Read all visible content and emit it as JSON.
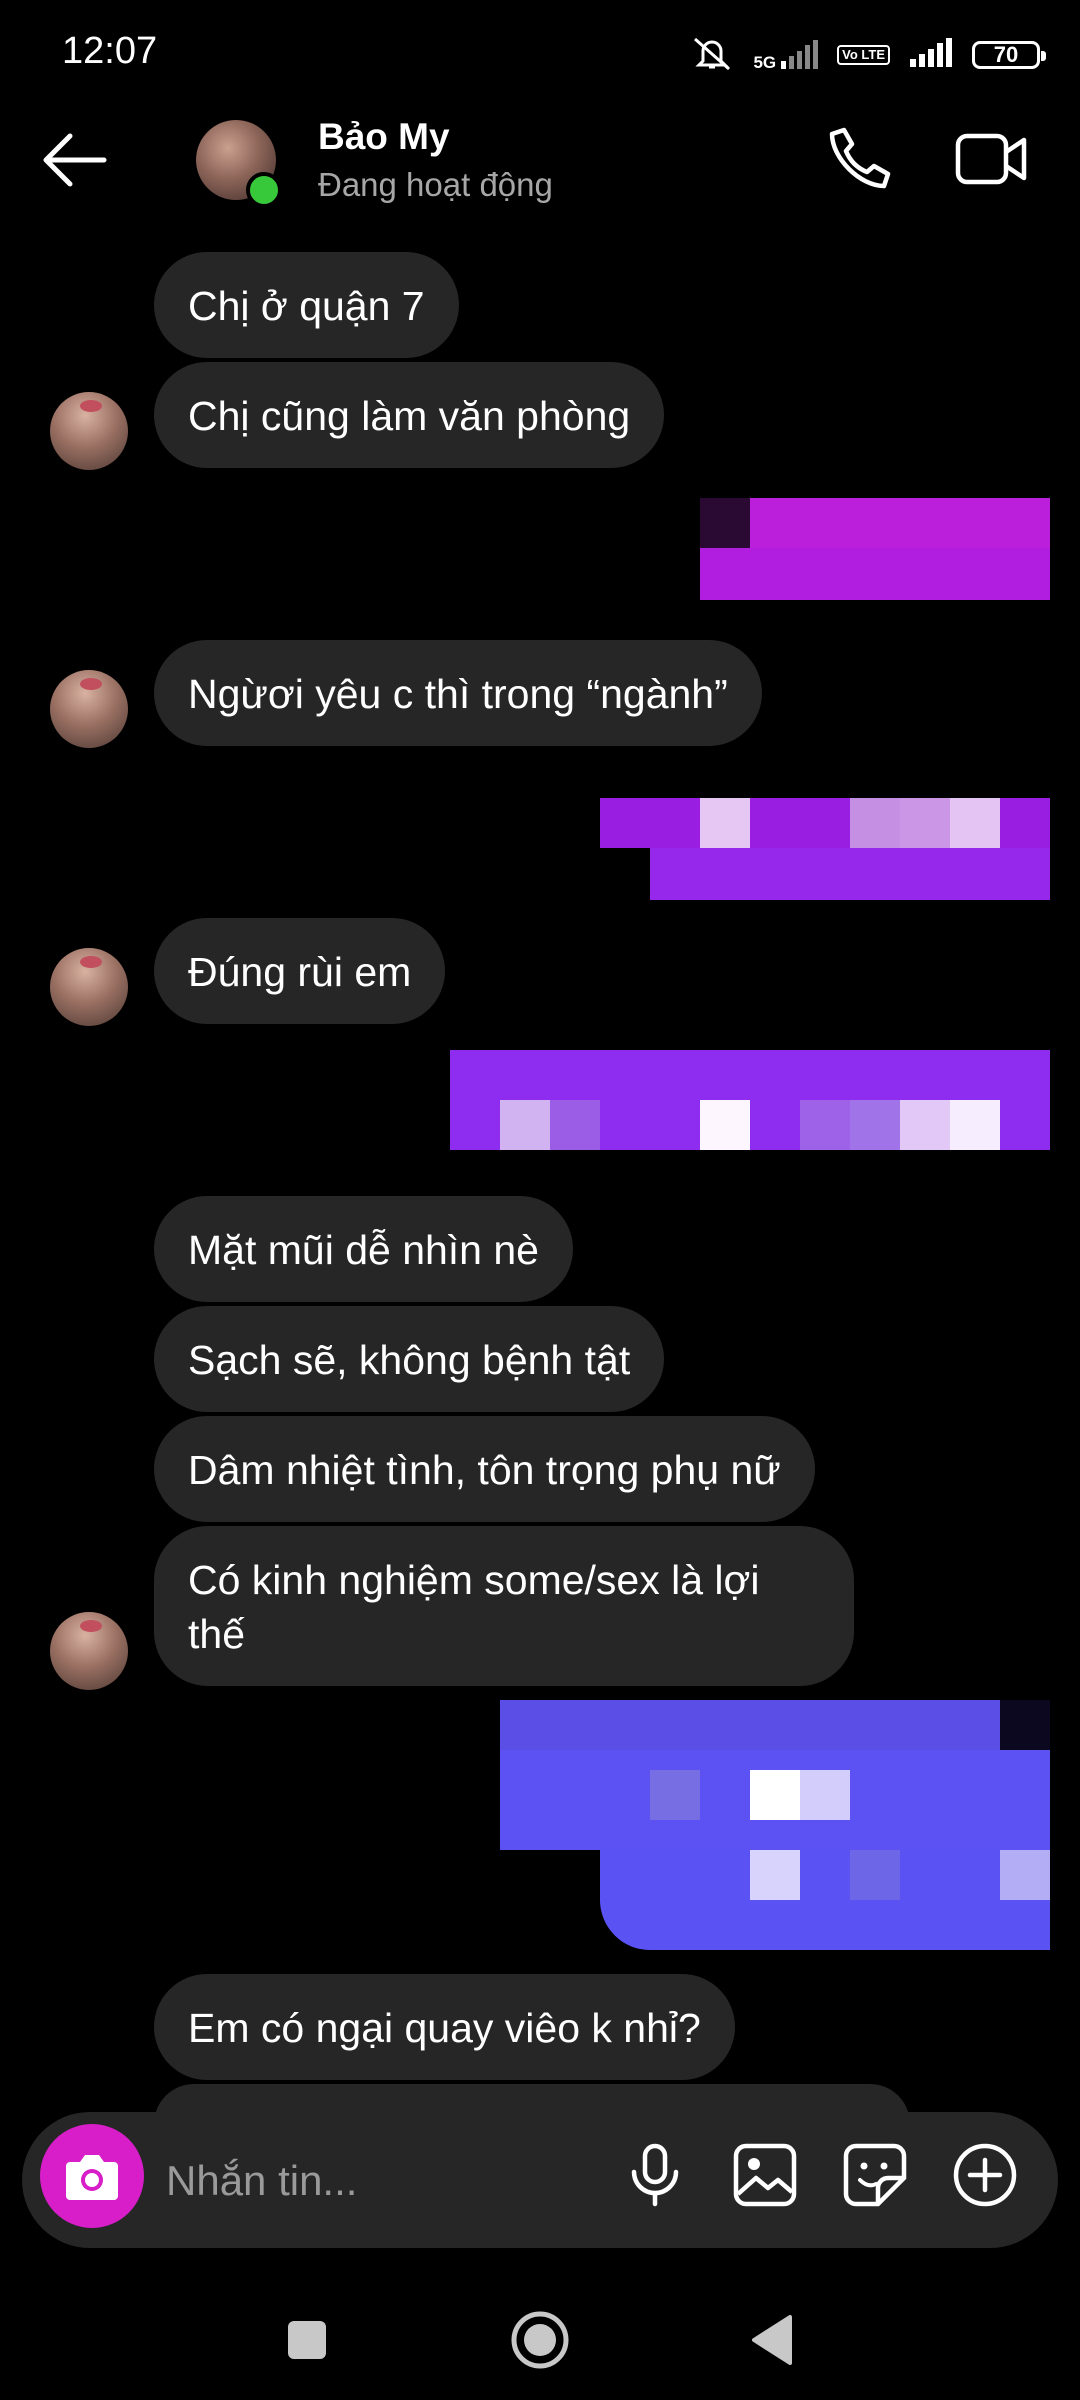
{
  "status_bar": {
    "time": "12:07",
    "network": "5G",
    "volte": "Vo LTE",
    "battery": "70"
  },
  "header": {
    "contact_name": "Bảo My",
    "contact_status": "Đang hoạt động",
    "back_icon": "back-arrow-icon",
    "call_icon": "phone-icon",
    "video_icon": "video-camera-icon"
  },
  "messages": [
    {
      "sender": "contact",
      "text": "Chị ở quận 7"
    },
    {
      "sender": "contact",
      "text": "Chị cũng làm văn phòng"
    },
    {
      "sender": "me",
      "text": "",
      "blurred": true
    },
    {
      "sender": "contact",
      "text": "Ngừơi yêu c thì trong “ngành”"
    },
    {
      "sender": "me",
      "text": "",
      "blurred": true
    },
    {
      "sender": "contact",
      "text": "Đúng rùi em"
    },
    {
      "sender": "me",
      "text": "",
      "blurred": true
    },
    {
      "sender": "contact",
      "text": "Mặt mũi dễ nhìn nè"
    },
    {
      "sender": "contact",
      "text": "Sạch sẽ, không bệnh tật"
    },
    {
      "sender": "contact",
      "text": "Dâm nhiệt tình, tôn trọng phụ nữ"
    },
    {
      "sender": "contact",
      "text": "Có kinh nghiệm some/sex là lợi thế"
    },
    {
      "sender": "me",
      "text": "",
      "blurred": true
    },
    {
      "sender": "contact",
      "text": "Em có ngại quay viêo k nhỉ?"
    }
  ],
  "composer": {
    "placeholder": "Nhắn tin...",
    "camera_icon": "camera-icon",
    "tools": [
      "microphone-icon",
      "image-icon",
      "sticker-icon",
      "plus-icon"
    ]
  },
  "nav_bar": [
    "recents-square-icon",
    "home-circle-icon",
    "back-triangle-icon"
  ],
  "colors": {
    "background": "#000000",
    "received_bubble": "#262626",
    "camera_button": "#d81ec8",
    "online": "#38c93b"
  }
}
